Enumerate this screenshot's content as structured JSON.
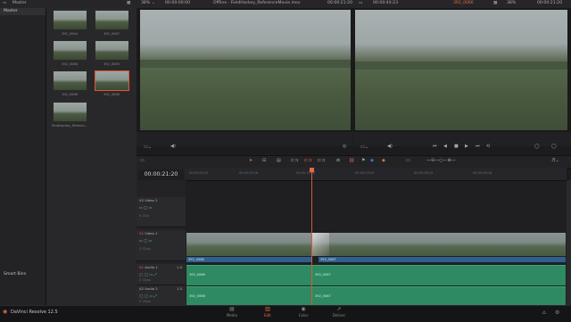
{
  "topbar": {
    "bin": "Master",
    "zoom_left": "38%",
    "timecode_1": "00:00:00:00",
    "title": "Offline - FieldHockey_ReferenceMovie.mov",
    "timecode_2": "00:00:21:20",
    "timecode_3": "00:00:44:23",
    "clip_name": "392_0066",
    "zoom_right": "38%",
    "timecode_4": "00:00:21:20"
  },
  "sidebar": {
    "master": "Master",
    "smart_bins": "Smart Bins"
  },
  "media_pool": {
    "clips": [
      {
        "label": "392_0064"
      },
      {
        "label": "392_0067"
      },
      {
        "label": "392_0066"
      },
      {
        "label": "392_0065"
      },
      {
        "label": "392_0078"
      },
      {
        "label": "392_0069"
      },
      {
        "label": "392_0066"
      },
      {
        "label": "392_0066"
      },
      {
        "label": "FieldHockey_Referen..."
      }
    ]
  },
  "timeline": {
    "timecode": "00:00:21:20",
    "ruler_ticks": [
      "00:00:00:00",
      "00:00:09:16",
      "00:00:19:10",
      "00:00:29:04",
      "00:00:38:22",
      "00:00:48:16"
    ],
    "tracks": {
      "v2": {
        "id": "V2",
        "name": "Video 2",
        "count": "0 Clip"
      },
      "v1": {
        "id": "V1",
        "name": "Video 1",
        "count": "2 Clips"
      },
      "a1": {
        "id": "A1",
        "name": "Audio 1",
        "level": "1.0",
        "count": "2 Clips"
      },
      "a2": {
        "id": "A2",
        "name": "Audio 2",
        "level": "1.0",
        "count": "2 Clips"
      }
    },
    "v1_clips": [
      "392_0066",
      "392_0067"
    ],
    "a1_clips": [
      "392_0066",
      "392_0067"
    ],
    "a2_clips": [
      "392_0066",
      "392_0067"
    ]
  },
  "bottombar": {
    "app": "DaVinci Resolve 12.5",
    "pages": {
      "media": "Media",
      "edit": "Edit",
      "color": "Color",
      "deliver": "Deliver"
    }
  },
  "icons": {
    "accent": "#e36a44",
    "video_blue": "#2e5f8d",
    "audio_green": "#2d8a62"
  }
}
